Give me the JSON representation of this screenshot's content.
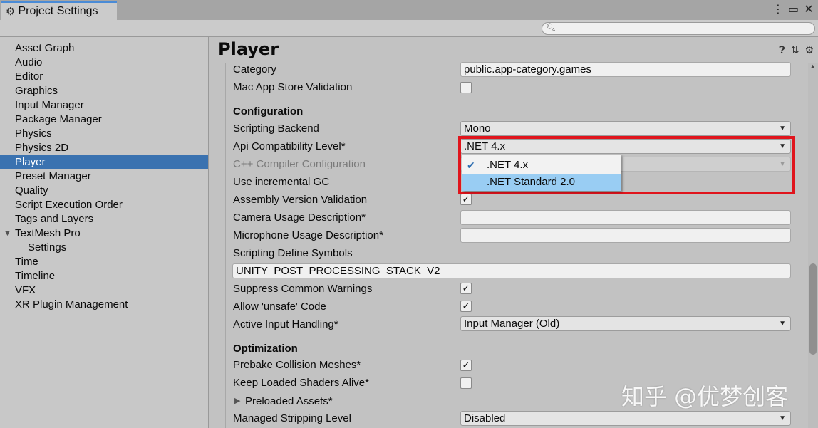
{
  "window": {
    "tab_title": "Project Settings",
    "tab_icon": "gear-icon",
    "controls": [
      "more-icon",
      "maximize-icon",
      "close-icon"
    ]
  },
  "search": {
    "placeholder": "",
    "value": ""
  },
  "sidebar": {
    "items": [
      {
        "label": "Asset Graph"
      },
      {
        "label": "Audio"
      },
      {
        "label": "Editor"
      },
      {
        "label": "Graphics"
      },
      {
        "label": "Input Manager"
      },
      {
        "label": "Package Manager"
      },
      {
        "label": "Physics"
      },
      {
        "label": "Physics 2D"
      },
      {
        "label": "Player",
        "selected": true
      },
      {
        "label": "Preset Manager"
      },
      {
        "label": "Quality"
      },
      {
        "label": "Script Execution Order"
      },
      {
        "label": "Tags and Layers"
      },
      {
        "label": "TextMesh Pro",
        "expanded": true
      },
      {
        "label": "Settings",
        "child": true
      },
      {
        "label": "Time"
      },
      {
        "label": "Timeline"
      },
      {
        "label": "VFX"
      },
      {
        "label": "XR Plugin Management"
      }
    ]
  },
  "main": {
    "title": "Player",
    "header_icons": [
      "help-icon",
      "presets-icon",
      "settings-gear-icon"
    ],
    "rows": {
      "category": {
        "label": "Category",
        "value": "public.app-category.games"
      },
      "mac_validation": {
        "label": "Mac App Store Validation",
        "checked": false
      },
      "configuration": {
        "label": "Configuration"
      },
      "scripting_backend": {
        "label": "Scripting Backend",
        "value": "Mono"
      },
      "api_level": {
        "label": "Api Compatibility Level*",
        "value": ".NET 4.x"
      },
      "cpp_config": {
        "label": "C++ Compiler Configuration",
        "value": ""
      },
      "incremental_gc": {
        "label": "Use incremental GC"
      },
      "assembly_validation": {
        "label": "Assembly Version Validation",
        "checked": true
      },
      "camera_usage": {
        "label": "Camera Usage Description*",
        "value": ""
      },
      "mic_usage": {
        "label": "Microphone Usage Description*",
        "value": ""
      },
      "define_symbols": {
        "label": "Scripting Define Symbols",
        "value": "UNITY_POST_PROCESSING_STACK_V2"
      },
      "suppress_warnings": {
        "label": "Suppress Common Warnings",
        "checked": true
      },
      "unsafe_code": {
        "label": "Allow 'unsafe' Code",
        "checked": true
      },
      "input_handling": {
        "label": "Active Input Handling*",
        "value": "Input Manager (Old)"
      },
      "optimization": {
        "label": "Optimization"
      },
      "prebake": {
        "label": "Prebake Collision Meshes*",
        "checked": true
      },
      "keep_shaders": {
        "label": "Keep Loaded Shaders Alive*",
        "checked": false
      },
      "preloaded": {
        "label": "Preloaded Assets*"
      },
      "stripping": {
        "label": "Managed Stripping Level",
        "value": "Disabled"
      }
    },
    "api_popup": {
      "options": [
        {
          "label": ".NET 4.x",
          "checked": true
        },
        {
          "label": ".NET Standard 2.0",
          "hovered": true
        }
      ]
    }
  },
  "watermark": "知乎 @优梦创客",
  "colors": {
    "selection": "#3a72b0",
    "highlight_box": "#e0141c",
    "popup_hover": "#99cdf3"
  }
}
